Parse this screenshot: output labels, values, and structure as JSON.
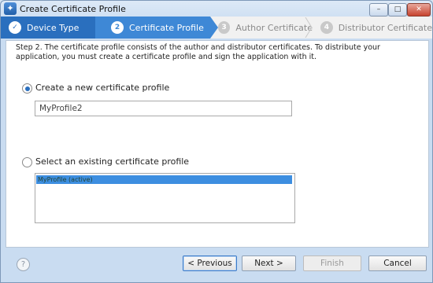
{
  "window": {
    "title": "Create Certificate Profile"
  },
  "title_buttons": {
    "minimize": "–",
    "maximize": "□",
    "close": "✕"
  },
  "steps": [
    {
      "number": "✓",
      "label": "Device Type",
      "state": "done"
    },
    {
      "number": "2",
      "label": "Certificate Profile",
      "state": "current"
    },
    {
      "number": "3",
      "label": "Author Certificate",
      "state": "future"
    },
    {
      "number": "4",
      "label": "Distributor Certificate",
      "state": "future"
    }
  ],
  "main": {
    "description": "Step 2. The certificate profile consists of the author and distributor certificates. To distribute your application, you must create a certificate profile and sign the application with it.",
    "option_new": {
      "label": "Create a new certificate profile",
      "selected": true
    },
    "profile_name": {
      "value": "MyProfile2"
    },
    "option_existing": {
      "label": "Select an existing certificate profile",
      "selected": false
    },
    "existing_profiles": [
      "MyProfile (active)"
    ]
  },
  "footer": {
    "help": "?",
    "previous": "< Previous",
    "next": "Next >",
    "finish": "Finish",
    "cancel": "Cancel"
  },
  "colors": {
    "step_done": "#2a6fbe",
    "step_current": "#3e88d6",
    "selection": "#3d8ee0"
  }
}
